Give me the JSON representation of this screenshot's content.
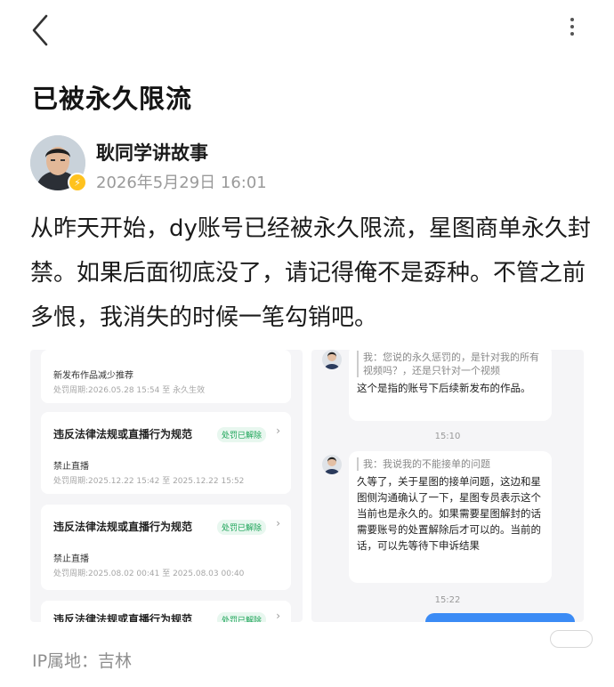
{
  "header": {
    "back_icon": "chevron-left-icon",
    "more_icon": "vertical-dots-icon"
  },
  "post": {
    "title": "已被永久限流",
    "author": "耿同学讲故事",
    "timestamp": "2026年5月29日 16:01",
    "body": "从昨天开始，dy账号已经被永久限流，星图商单永久封禁。如果后面彻底没了，请记得俺不是孬种。不管之前多恨，我消失的时候一笔勾销吧。",
    "ip_location": "IP属地：吉林"
  },
  "left_screenshot": {
    "top_item": {
      "title": "新发布作品减少推荐",
      "date": "处罚周期:2026.05.28 15:54 至 永久生效"
    },
    "cards": [
      {
        "title": "违反法律法规或直播行为规范",
        "status": "处罚已解除",
        "penalty": "禁止直播",
        "date": "处罚周期:2025.12.22 15:42 至 2025.12.22 15:52"
      },
      {
        "title": "违反法律法规或直播行为规范",
        "status": "处罚已解除",
        "penalty": "禁止直播",
        "date": "处罚周期:2025.08.02 00:41 至 2025.08.03 00:40"
      },
      {
        "title": "违反法律法规或直播行为规范",
        "status": "处罚已解除"
      }
    ]
  },
  "right_screenshot": {
    "msg1_quote": "我：您说的永久惩罚的，是针对我的所有视频吗？，还是只针对一个视频",
    "msg1_text": "这个是指的账号下后续新发布的作品。",
    "time1": "15:10",
    "msg2_quote": "我：我说我的不能接单的问题",
    "msg2_text": "久等了，关于星图的接单问题，这边和星图侧沟通确认了一下，星图专员表示这个当前也是永久的。如果需要星图解封的话 需要账号的处置解除后才可以的。当前的话，可以先等待下申诉结果",
    "time2": "15:22"
  }
}
